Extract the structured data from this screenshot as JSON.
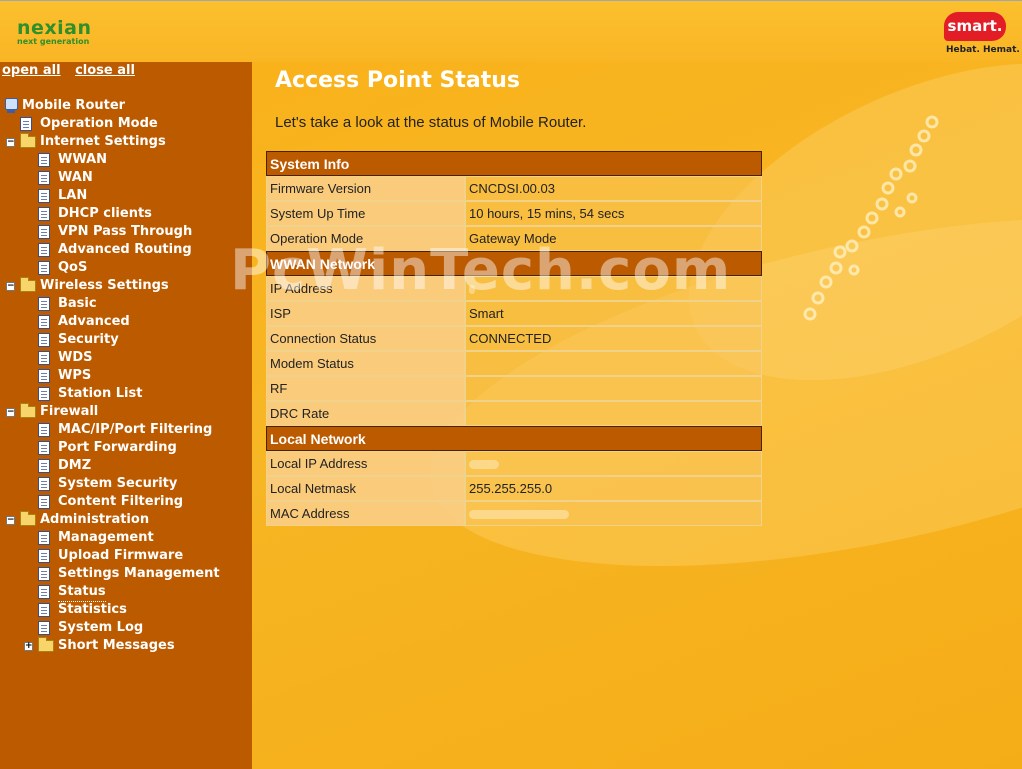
{
  "header": {
    "brand_name": "nexian",
    "brand_tagline": "next generation",
    "partner_logo": "smart.",
    "partner_slogan": "Hebat. Hemat."
  },
  "sidebar": {
    "open_all": "open all",
    "close_all": "close all",
    "root": "Mobile Router",
    "items": [
      {
        "label": "Operation Mode",
        "type": "page"
      },
      {
        "label": "Internet Settings",
        "type": "folder"
      },
      {
        "label": "WWAN",
        "type": "page"
      },
      {
        "label": "WAN",
        "type": "page"
      },
      {
        "label": "LAN",
        "type": "page"
      },
      {
        "label": "DHCP clients",
        "type": "page"
      },
      {
        "label": "VPN Pass Through",
        "type": "page"
      },
      {
        "label": "Advanced Routing",
        "type": "page"
      },
      {
        "label": "QoS",
        "type": "page"
      },
      {
        "label": "Wireless Settings",
        "type": "folder"
      },
      {
        "label": "Basic",
        "type": "page"
      },
      {
        "label": "Advanced",
        "type": "page"
      },
      {
        "label": "Security",
        "type": "page"
      },
      {
        "label": "WDS",
        "type": "page"
      },
      {
        "label": "WPS",
        "type": "page"
      },
      {
        "label": "Station List",
        "type": "page"
      },
      {
        "label": "Firewall",
        "type": "folder"
      },
      {
        "label": "MAC/IP/Port Filtering",
        "type": "page"
      },
      {
        "label": "Port Forwarding",
        "type": "page"
      },
      {
        "label": "DMZ",
        "type": "page"
      },
      {
        "label": "System Security",
        "type": "page"
      },
      {
        "label": "Content Filtering",
        "type": "page"
      },
      {
        "label": "Administration",
        "type": "folder"
      },
      {
        "label": "Management",
        "type": "page"
      },
      {
        "label": "Upload Firmware",
        "type": "page"
      },
      {
        "label": "Settings Management",
        "type": "page"
      },
      {
        "label": "Status",
        "type": "page",
        "current": true
      },
      {
        "label": "Statistics",
        "type": "page"
      },
      {
        "label": "System Log",
        "type": "page"
      },
      {
        "label": "Short Messages",
        "type": "folder"
      }
    ]
  },
  "main": {
    "title": "Access Point Status",
    "description": "Let's take a look at the status of Mobile Router.",
    "sections": [
      {
        "title": "System Info",
        "rows": [
          {
            "key": "Firmware Version",
            "value": "CNCDSI.00.03"
          },
          {
            "key": "System Up Time",
            "value": "10 hours, 15 mins, 54 secs"
          },
          {
            "key": "Operation Mode",
            "value": "Gateway Mode"
          }
        ]
      },
      {
        "title": "WWAN Network",
        "rows": [
          {
            "key": "IP Address",
            "value": ""
          },
          {
            "key": "ISP",
            "value": "Smart"
          },
          {
            "key": "Connection Status",
            "value": "CONNECTED"
          },
          {
            "key": "Modem Status",
            "value": ""
          },
          {
            "key": "RF",
            "value": ""
          },
          {
            "key": "DRC Rate",
            "value": ""
          }
        ]
      },
      {
        "title": "Local Network",
        "rows": [
          {
            "key": "Local IP Address",
            "value": ""
          },
          {
            "key": "Local Netmask",
            "value": "255.255.255.0"
          },
          {
            "key": "MAC Address",
            "value": ""
          }
        ]
      }
    ]
  },
  "watermark": "PcWinTech.com",
  "colors": {
    "sidebar_bg": "#bc5a00",
    "page_bg": "#f7b51d",
    "section_header_bg": "#bc5a00",
    "brand_green": "#2f8f2a",
    "partner_red": "#e31d25"
  }
}
